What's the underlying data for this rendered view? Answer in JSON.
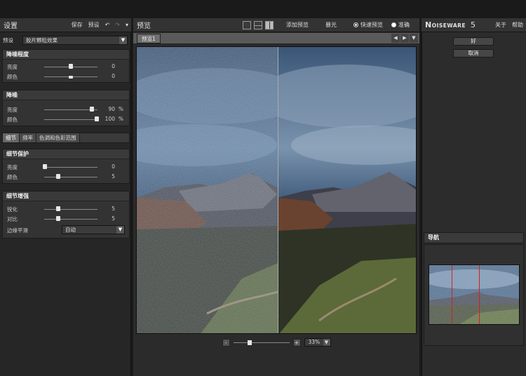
{
  "left_panel": {
    "title": "设置",
    "save_label": "保存",
    "preset_label": "预设",
    "preset_row_label": "预设",
    "preset_value": "胶片颗粒效果"
  },
  "noise_level": {
    "title": "降噪程度",
    "rows": [
      {
        "label": "亮度",
        "value": "0"
      },
      {
        "label": "颜色",
        "value": "0"
      }
    ]
  },
  "noise_reduction": {
    "title": "降噪",
    "rows": [
      {
        "label": "亮度",
        "value": "90",
        "unit": "%"
      },
      {
        "label": "颜色",
        "value": "100",
        "unit": "%"
      }
    ]
  },
  "tabs": [
    "细节",
    "频率",
    "色调和色彩范围"
  ],
  "detail_protection": {
    "title": "细节保护",
    "rows": [
      {
        "label": "亮度",
        "value": "0"
      },
      {
        "label": "颜色",
        "value": "5"
      }
    ]
  },
  "detail_enhance": {
    "title": "细节增强",
    "rows": [
      {
        "label": "锐化",
        "value": "5"
      },
      {
        "label": "对比",
        "value": "5"
      }
    ],
    "edge_label": "边缘平滑",
    "edge_value": "自动"
  },
  "center_panel": {
    "title": "预览",
    "add_preview": "添加预览",
    "exposure": "暴光",
    "fast_preview": "快速预览",
    "accurate": "准确",
    "preview_tab": "预览1",
    "zoom_value": "33%"
  },
  "right_panel": {
    "app_name_n": "N",
    "app_name_rest": "OISEWARE",
    "app_version": "5",
    "about": "关于",
    "help": "帮助",
    "ok": "好",
    "cancel": "取消",
    "navigator_title": "导航"
  }
}
